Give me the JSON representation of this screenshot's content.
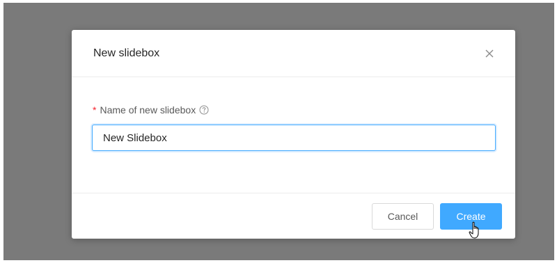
{
  "dialog": {
    "title": "New slidebox",
    "close_icon": "close-icon"
  },
  "form": {
    "required_marker": "*",
    "label": "Name of new slidebox",
    "help_icon": "question-circle-icon",
    "input_value": "New Slidebox"
  },
  "footer": {
    "cancel_label": "Cancel",
    "create_label": "Create"
  },
  "colors": {
    "primary": "#40a9ff",
    "required": "#f5222d",
    "overlay": "#7a7a7a"
  }
}
